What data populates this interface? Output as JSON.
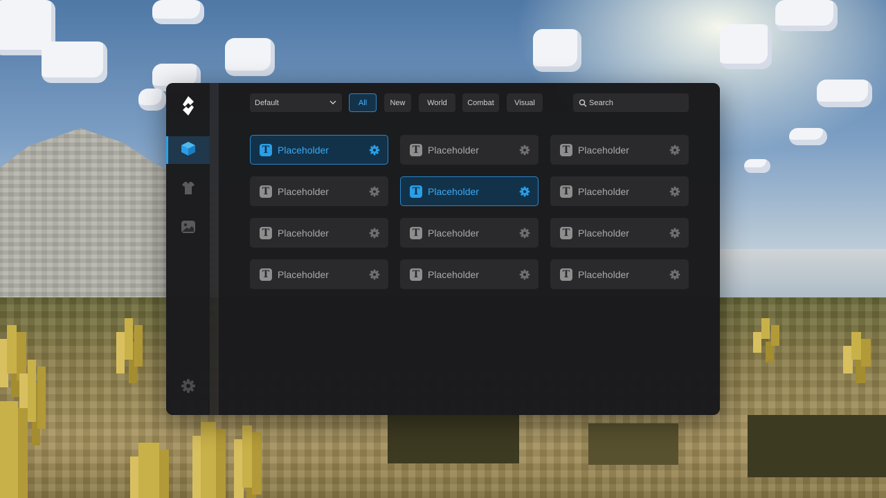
{
  "colors": {
    "accent": "#2aa0e8",
    "card_bg": "#2a2a2d",
    "card_active_bg": "#12324a",
    "text_muted": "#a9a9a9"
  },
  "sidebar": {
    "logo_icon": "client-logo-icon",
    "items": [
      {
        "icon": "cube-icon",
        "active": true
      },
      {
        "icon": "shirt-icon",
        "active": false
      },
      {
        "icon": "image-icon",
        "active": false
      }
    ],
    "settings_icon": "gear-icon"
  },
  "toolbar": {
    "preset_value": "Default",
    "tabs": [
      {
        "label": "All",
        "active": true
      },
      {
        "label": "New",
        "active": false
      },
      {
        "label": "World",
        "active": false
      },
      {
        "label": "Combat",
        "active": false
      },
      {
        "label": "Visual",
        "active": false
      }
    ],
    "search_placeholder": "Search"
  },
  "modules": [
    {
      "icon_letter": "T",
      "label": "Placeholder",
      "enabled": true
    },
    {
      "icon_letter": "T",
      "label": "Placeholder",
      "enabled": false
    },
    {
      "icon_letter": "T",
      "label": "Placeholder",
      "enabled": false
    },
    {
      "icon_letter": "T",
      "label": "Placeholder",
      "enabled": false
    },
    {
      "icon_letter": "T",
      "label": "Placeholder",
      "enabled": true
    },
    {
      "icon_letter": "T",
      "label": "Placeholder",
      "enabled": false
    },
    {
      "icon_letter": "T",
      "label": "Placeholder",
      "enabled": false
    },
    {
      "icon_letter": "T",
      "label": "Placeholder",
      "enabled": false
    },
    {
      "icon_letter": "T",
      "label": "Placeholder",
      "enabled": false
    },
    {
      "icon_letter": "T",
      "label": "Placeholder",
      "enabled": false
    },
    {
      "icon_letter": "T",
      "label": "Placeholder",
      "enabled": false
    },
    {
      "icon_letter": "T",
      "label": "Placeholder",
      "enabled": false
    }
  ]
}
